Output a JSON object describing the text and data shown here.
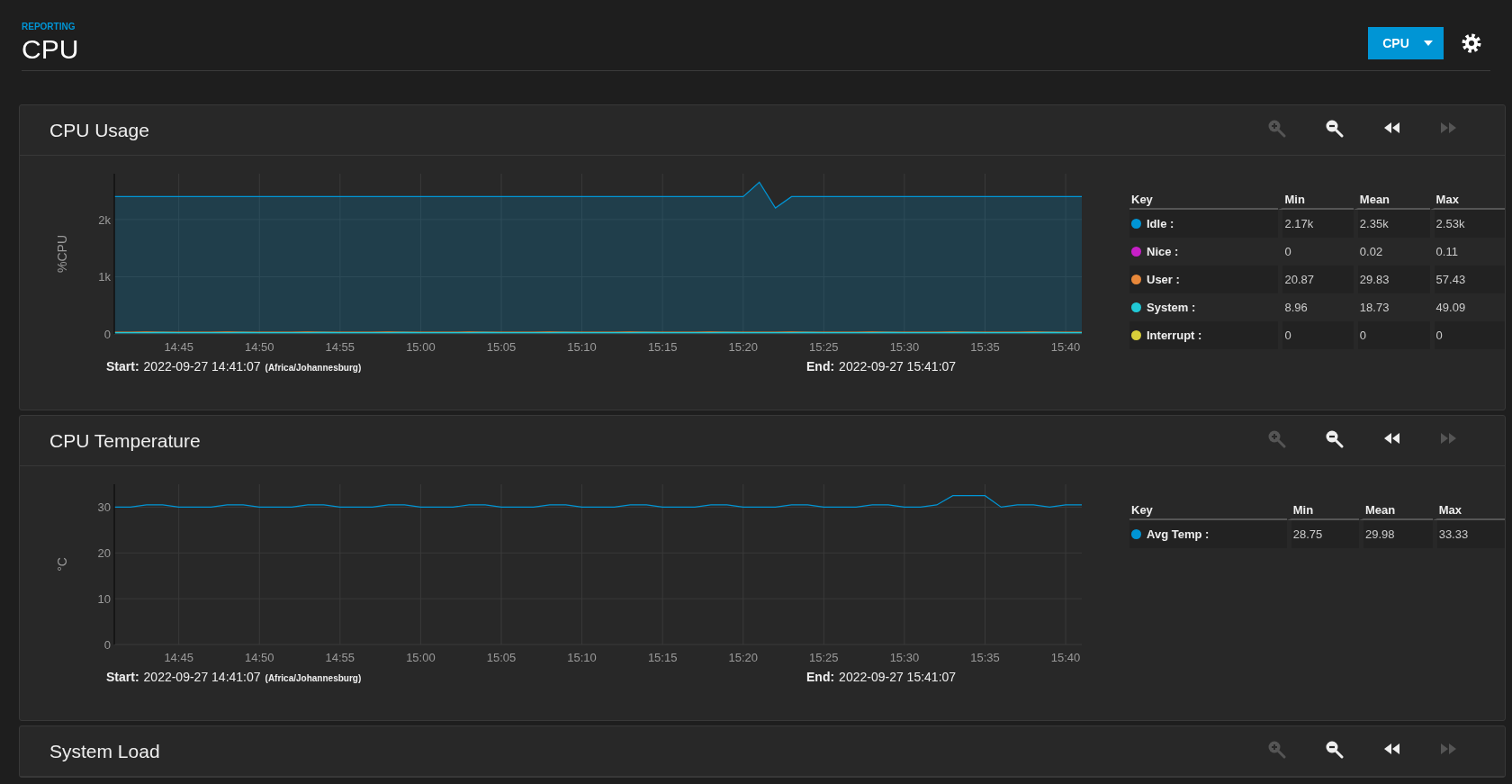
{
  "header": {
    "breadcrumb": "REPORTING",
    "title": "CPU",
    "report_button": {
      "label": "CPU"
    }
  },
  "cards": [
    {
      "title": "CPU Usage",
      "tools": [
        {
          "kind": "zoom_in",
          "disabled": true
        },
        {
          "kind": "zoom_out",
          "disabled": false
        },
        {
          "kind": "back",
          "disabled": false
        },
        {
          "kind": "forward",
          "disabled": true
        }
      ],
      "chart_data": {
        "type": "line",
        "ylabel": "%CPU",
        "grid": true,
        "ylim": [
          0,
          2800
        ],
        "categories": [
          null,
          null,
          null,
          null,
          "14:45",
          null,
          null,
          null,
          null,
          "14:50",
          null,
          null,
          null,
          null,
          "14:55",
          null,
          null,
          null,
          null,
          "15:00",
          null,
          null,
          null,
          null,
          "15:05",
          null,
          null,
          null,
          null,
          "15:10",
          null,
          null,
          null,
          null,
          "15:15",
          null,
          null,
          null,
          null,
          "15:20",
          null,
          null,
          null,
          null,
          "15:25",
          null,
          null,
          null,
          null,
          "15:30",
          null,
          null,
          null,
          null,
          "15:35",
          null,
          null,
          null,
          null,
          "15:40",
          null
        ],
        "yticks": [
          {
            "value": 0,
            "label": "0"
          },
          {
            "value": 1000,
            "label": "1k"
          },
          {
            "value": 2000,
            "label": "2k"
          }
        ],
        "series": [
          {
            "name": "Idle",
            "type": "area",
            "color": "#0095d5",
            "values": [
              2400,
              2400,
              2400,
              2400,
              2400,
              2400,
              2400,
              2400,
              2400,
              2400,
              2400,
              2400,
              2400,
              2400,
              2400,
              2400,
              2400,
              2400,
              2400,
              2400,
              2400,
              2400,
              2400,
              2400,
              2400,
              2400,
              2400,
              2400,
              2400,
              2400,
              2400,
              2400,
              2400,
              2400,
              2400,
              2400,
              2400,
              2400,
              2400,
              2400,
              2650,
              2200,
              2400,
              2400,
              2400,
              2400,
              2400,
              2400,
              2400,
              2400,
              2400,
              2400,
              2400,
              2400,
              2400,
              2400,
              2400,
              2400,
              2400,
              2400,
              2400
            ]
          },
          {
            "name": "Nice",
            "type": "line",
            "color": "#c71fc7",
            "values": [
              null,
              null,
              null,
              null,
              null,
              null,
              null,
              null,
              null,
              null,
              null,
              null,
              null,
              null,
              null,
              null,
              null,
              null,
              null,
              null,
              null,
              null,
              null,
              null,
              null,
              null,
              null,
              null,
              null,
              null,
              null,
              null,
              null,
              null,
              null,
              null,
              null,
              null,
              null,
              null,
              null,
              null,
              null,
              null,
              null,
              null,
              null,
              null,
              null,
              null,
              null,
              null,
              null,
              null,
              null,
              null,
              null,
              null,
              null,
              null,
              null
            ]
          },
          {
            "name": "User",
            "type": "line",
            "color": "#e8883a",
            "values": [
              30,
              30,
              35,
              30,
              30,
              30,
              30,
              35,
              30,
              30,
              30,
              30,
              35,
              30,
              30,
              30,
              30,
              35,
              30,
              30,
              30,
              30,
              35,
              30,
              30,
              30,
              30,
              35,
              30,
              30,
              30,
              30,
              35,
              30,
              30,
              30,
              30,
              35,
              30,
              30,
              30,
              30,
              35,
              30,
              30,
              30,
              30,
              35,
              30,
              30,
              30,
              30,
              35,
              30,
              30,
              30,
              30,
              35,
              30,
              30,
              30
            ]
          },
          {
            "name": "System",
            "type": "line",
            "color": "#21c9d6",
            "values": [
              20,
              20,
              20,
              25,
              20,
              20,
              20,
              20,
              25,
              20,
              20,
              20,
              20,
              25,
              20,
              20,
              20,
              20,
              25,
              20,
              20,
              20,
              20,
              25,
              20,
              20,
              20,
              20,
              25,
              20,
              20,
              20,
              20,
              25,
              20,
              20,
              20,
              20,
              25,
              20,
              20,
              20,
              20,
              25,
              20,
              20,
              20,
              20,
              25,
              20,
              20,
              20,
              20,
              25,
              20,
              20,
              20,
              20,
              25,
              20,
              20
            ]
          },
          {
            "name": "Interrupt",
            "type": "line",
            "color": "#d8cf3a",
            "values": [
              null,
              null,
              null,
              null,
              null,
              null,
              null,
              null,
              null,
              null,
              null,
              null,
              null,
              null,
              null,
              null,
              null,
              null,
              null,
              null,
              null,
              null,
              null,
              null,
              null,
              null,
              null,
              null,
              null,
              null,
              null,
              null,
              null,
              null,
              null,
              null,
              null,
              null,
              null,
              null,
              null,
              null,
              null,
              null,
              null,
              null,
              null,
              null,
              null,
              null,
              null,
              null,
              null,
              null,
              null,
              null,
              null,
              null,
              null,
              null,
              null
            ]
          }
        ]
      },
      "start_label": "Start:",
      "start_value": "2022-09-27 14:41:07",
      "timezone": "(Africa/Johannesburg)",
      "end_label": "End:",
      "end_value": "2022-09-27 15:41:07",
      "legend": {
        "columns": [
          "Key",
          "Min",
          "Mean",
          "Max"
        ],
        "rows": [
          {
            "suffix": ":",
            "min": "2.17k",
            "mean": "2.35k",
            "max": "2.53k"
          },
          {
            "suffix": ":",
            "min": "0",
            "mean": "0.02",
            "max": "0.11"
          },
          {
            "suffix": ":",
            "min": "20.87",
            "mean": "29.83",
            "max": "57.43"
          },
          {
            "suffix": ":",
            "min": "8.96",
            "mean": "18.73",
            "max": "49.09"
          },
          {
            "suffix": ":",
            "min": "0",
            "mean": "0",
            "max": "0"
          }
        ]
      }
    },
    {
      "title": "CPU Temperature",
      "tools": [
        {
          "kind": "zoom_in",
          "disabled": true
        },
        {
          "kind": "zoom_out",
          "disabled": false
        },
        {
          "kind": "back",
          "disabled": false
        },
        {
          "kind": "forward",
          "disabled": true
        }
      ],
      "chart_data": {
        "type": "line",
        "ylabel": "°C",
        "grid": true,
        "ylim": [
          0,
          35
        ],
        "categories": [
          null,
          null,
          null,
          null,
          "14:45",
          null,
          null,
          null,
          null,
          "14:50",
          null,
          null,
          null,
          null,
          "14:55",
          null,
          null,
          null,
          null,
          "15:00",
          null,
          null,
          null,
          null,
          "15:05",
          null,
          null,
          null,
          null,
          "15:10",
          null,
          null,
          null,
          null,
          "15:15",
          null,
          null,
          null,
          null,
          "15:20",
          null,
          null,
          null,
          null,
          "15:25",
          null,
          null,
          null,
          null,
          "15:30",
          null,
          null,
          null,
          null,
          "15:35",
          null,
          null,
          null,
          null,
          "15:40",
          null
        ],
        "yticks": [
          {
            "value": 0,
            "label": "0"
          },
          {
            "value": 10,
            "label": "10"
          },
          {
            "value": 20,
            "label": "20"
          },
          {
            "value": 30,
            "label": "30"
          }
        ],
        "series": [
          {
            "name": "Avg Temp",
            "type": "line",
            "color": "#0095d5",
            "values": [
              30,
              30,
              30.5,
              30.5,
              30,
              30,
              30,
              30.5,
              30.5,
              30,
              30,
              30,
              30.5,
              30.5,
              30,
              30,
              30,
              30.5,
              30.5,
              30,
              30,
              30,
              30.5,
              30.5,
              30,
              30,
              30,
              30.5,
              30.5,
              30,
              30,
              30,
              30.5,
              30.5,
              30,
              30,
              30,
              30.5,
              30.5,
              30,
              30,
              30,
              30.5,
              30.5,
              30,
              30,
              30,
              30.5,
              30.5,
              30,
              30,
              30.5,
              32.5,
              32.5,
              32.5,
              30,
              30.5,
              30.5,
              30,
              30.5,
              30.5
            ]
          }
        ]
      },
      "start_label": "Start:",
      "start_value": "2022-09-27 14:41:07",
      "timezone": "(Africa/Johannesburg)",
      "end_label": "End:",
      "end_value": "2022-09-27 15:41:07",
      "legend": {
        "columns": [
          "Key",
          "Min",
          "Mean",
          "Max"
        ],
        "rows": [
          {
            "suffix": ":",
            "min": "28.75",
            "mean": "29.98",
            "max": "33.33"
          }
        ]
      }
    },
    {
      "title": "System Load",
      "tools": [
        {
          "kind": "zoom_in",
          "disabled": true
        },
        {
          "kind": "zoom_out",
          "disabled": false
        },
        {
          "kind": "back",
          "disabled": false
        },
        {
          "kind": "forward",
          "disabled": true
        }
      ]
    }
  ]
}
